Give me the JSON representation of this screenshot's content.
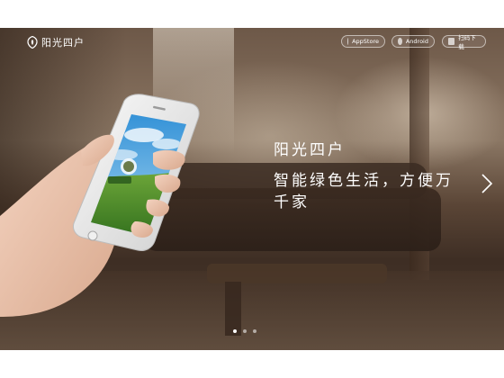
{
  "brand": {
    "name": "阳光四户"
  },
  "nav": {
    "appstore_label": "AppStore",
    "android_label": "Android",
    "scan_label": "扫码下载"
  },
  "hero": {
    "title": "阳光四户",
    "subtitle": "智能绿色生活，方便万千家"
  },
  "slider": {
    "count": 3,
    "active": 1
  },
  "icons": {
    "logo": "leaf-shield-icon",
    "appstore": "apple-icon",
    "android": "android-icon",
    "scan": "qr-code-icon",
    "next": "chevron-right-icon"
  },
  "colors": {
    "text": "#ffffff",
    "grass": "#4a8f2e",
    "sky": "#4aa3e0"
  }
}
